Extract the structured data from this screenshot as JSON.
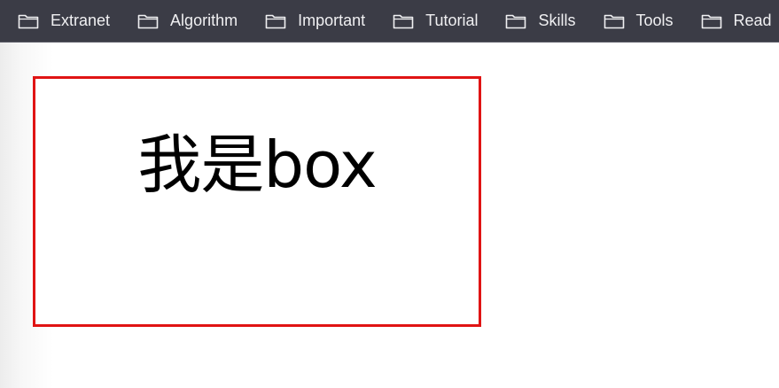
{
  "bookmarks_bar": {
    "items": [
      {
        "label": "Extranet",
        "icon": "folder-icon"
      },
      {
        "label": "Algorithm",
        "icon": "folder-icon"
      },
      {
        "label": "Important",
        "icon": "folder-icon"
      },
      {
        "label": "Tutorial",
        "icon": "folder-icon"
      },
      {
        "label": "Skills",
        "icon": "folder-icon"
      },
      {
        "label": "Tools",
        "icon": "folder-icon"
      },
      {
        "label": "Read",
        "icon": "folder-icon"
      }
    ]
  },
  "page": {
    "box": {
      "text": "我是box",
      "border_color": "#e01414"
    }
  },
  "colors": {
    "bookmarks_bar_background": "#3b3c46",
    "bookmark_text": "#f0f0f2",
    "page_background": "#ffffff"
  }
}
